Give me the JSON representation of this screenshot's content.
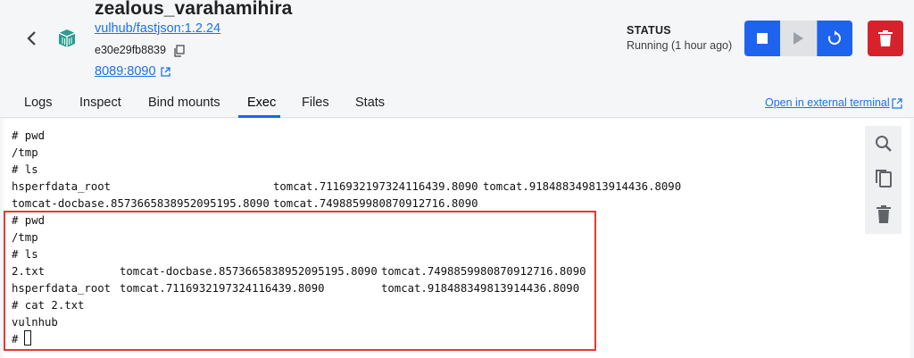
{
  "container": {
    "name": "zealous_varahamihira",
    "image": "vulhub/fastjson:1.2.24",
    "id": "e30e29fb8839",
    "port": "8089:8090"
  },
  "status": {
    "label": "STATUS",
    "value": "Running (1 hour ago)"
  },
  "tabs": [
    {
      "label": "Logs"
    },
    {
      "label": "Inspect"
    },
    {
      "label": "Bind mounts"
    },
    {
      "label": "Exec",
      "active": true
    },
    {
      "label": "Files"
    },
    {
      "label": "Stats"
    }
  ],
  "external_terminal_label": "Open in external terminal",
  "terminal": {
    "lines": [
      "# pwd",
      "/tmp",
      "# ls"
    ],
    "ls1_row1": [
      "hsperfdata_root",
      "tomcat.7116932197324116439.8090",
      "tomcat.918488349813914436.8090"
    ],
    "ls1_row2": [
      "tomcat-docbase.8573665838952095195.8090",
      "tomcat.7498859980870912716.8090"
    ],
    "lines2": [
      "# pwd",
      "/tmp",
      "# ls"
    ],
    "ls2_row1": [
      "2.txt",
      "tomcat-docbase.8573665838952095195.8090",
      "tomcat.7498859980870912716.8090"
    ],
    "ls2_row2": [
      "hsperfdata_root",
      "tomcat.7116932197324116439.8090",
      "tomcat.918488349813914436.8090"
    ],
    "lines3": [
      "# cat 2.txt",
      "vulnhub",
      "#"
    ]
  },
  "colors": {
    "accent": "#1d63ed",
    "danger": "#d7222b",
    "highlight": "#e53935"
  },
  "icons": {
    "back": "chevron-left-icon",
    "container": "container-icon",
    "copy": "copy-icon",
    "external": "external-link-icon",
    "stop": "stop-icon",
    "play": "play-icon",
    "restart": "restart-icon",
    "delete": "trash-icon",
    "search": "search-icon",
    "copy_output": "copy-icon",
    "clear": "trash-icon"
  }
}
